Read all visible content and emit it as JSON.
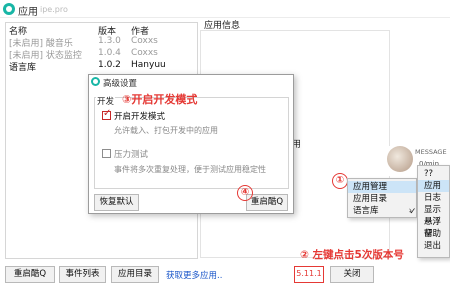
{
  "window": {
    "title": "应用",
    "watermark": "ipe.pro"
  },
  "list": {
    "headers": {
      "name": "名称",
      "version": "版本",
      "author": "作者"
    },
    "rows": [
      {
        "name": "[未启用] 酸音乐",
        "version": "1.3.0",
        "author": "Coxxs",
        "state": "disabled"
      },
      {
        "name": "[未启用] 状态监控",
        "version": "1.0.4",
        "author": "Coxxs",
        "state": "disabled"
      },
      {
        "name": "语言库",
        "version": "1.0.2",
        "author": "Hanyuu",
        "state": "enabled"
      }
    ]
  },
  "info": {
    "title": "应用信息",
    "fragment": "用"
  },
  "bottom": {
    "restart": "重启酷Q",
    "events": "事件列表",
    "app_dir": "应用目录",
    "more_link": "获取更多应用..",
    "version": "5.11.1",
    "close": "关闭"
  },
  "dialog": {
    "title": "高级设置",
    "group": "开发",
    "dev_mode": {
      "label": "开启开发模式",
      "desc": "允许载入、打包开发中的应用",
      "checked": true
    },
    "stress": {
      "label": "压力测试",
      "desc": "事件将多次重复处理，便于测试应用稳定性",
      "checked": false
    },
    "reset": "恢复默认",
    "restart": "重启酷Q"
  },
  "menu_main": {
    "items": [
      {
        "label": "应用管理",
        "highlight": true,
        "submenu": true
      },
      {
        "label": "应用目录",
        "highlight": false,
        "submenu": false
      },
      {
        "label": "语言库",
        "highlight": false,
        "submenu": true
      }
    ]
  },
  "menu_sub": {
    "items": [
      {
        "label": "??",
        "highlight": false,
        "tick": false
      },
      {
        "label": "应用",
        "highlight": true,
        "tick": false
      },
      {
        "label": "日志",
        "highlight": false,
        "tick": false
      },
      {
        "label": "显示悬浮",
        "highlight": false,
        "tick": true
      },
      {
        "label": "悬浮窗",
        "highlight": false,
        "tick": false
      },
      {
        "label": "帮助",
        "highlight": false,
        "tick": false
      },
      {
        "label": "退出",
        "highlight": false,
        "tick": false
      }
    ]
  },
  "notification": {
    "title": "MESSAGE",
    "sub": "0/min"
  },
  "annotations": {
    "step1": "①",
    "step2": "② 左键点击5次版本号",
    "step3": "③开启开发模式",
    "step4": "④"
  },
  "colors": {
    "accent": "#e53935",
    "logo": "#18b6a6",
    "link": "#1a56c9",
    "highlight": "#cce4f7"
  }
}
